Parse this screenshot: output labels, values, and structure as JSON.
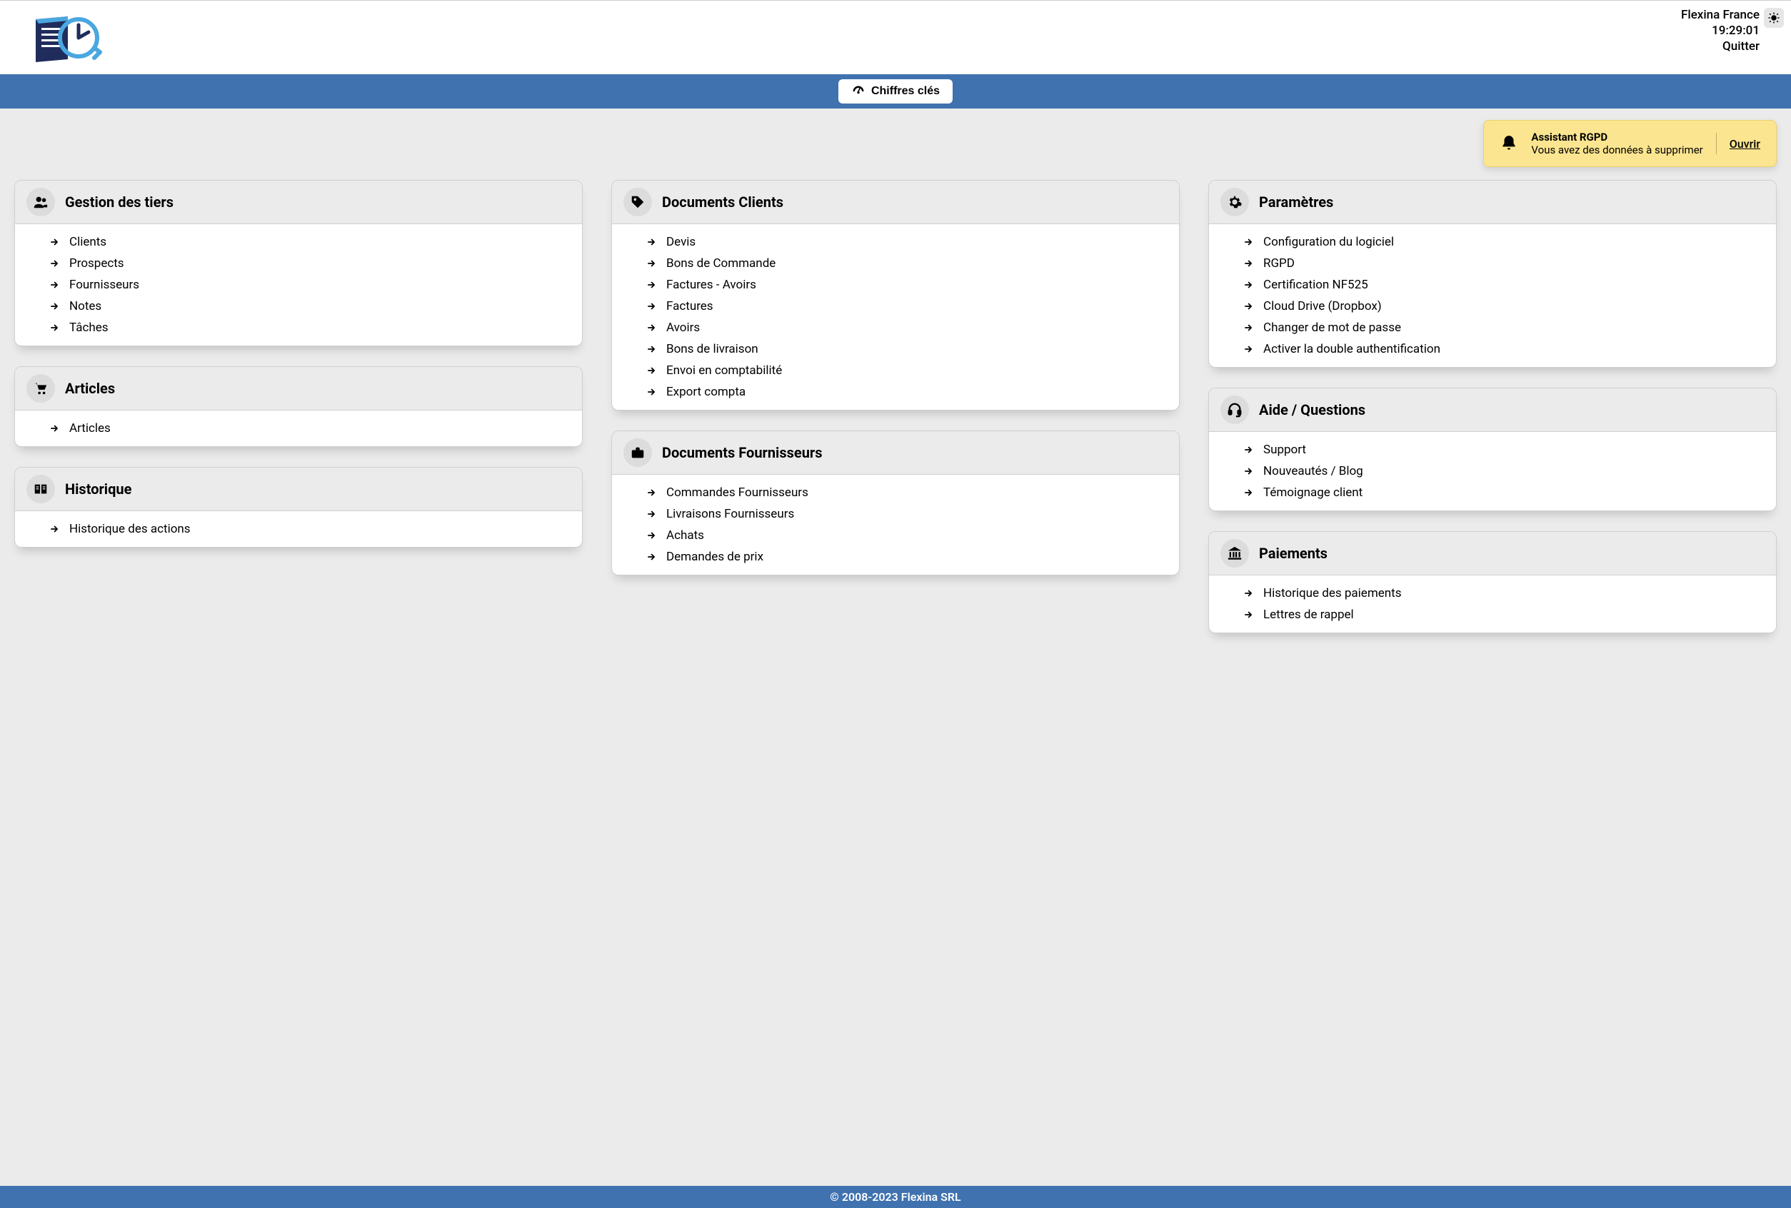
{
  "header": {
    "company": "Flexina France",
    "clock": "19:29:01",
    "quit": "Quitter"
  },
  "toolbar": {
    "chiffres": "Chiffres clés"
  },
  "notification": {
    "title": "Assistant RGPD",
    "body": "Vous avez des données à supprimer",
    "open": "Ouvrir"
  },
  "cards": {
    "tiers": {
      "title": "Gestion des tiers",
      "items": [
        "Clients",
        "Prospects",
        "Fournisseurs",
        "Notes",
        "Tâches"
      ]
    },
    "articles": {
      "title": "Articles",
      "items": [
        "Articles"
      ]
    },
    "historique": {
      "title": "Historique",
      "items": [
        "Historique des actions"
      ]
    },
    "docs_clients": {
      "title": "Documents Clients",
      "items": [
        "Devis",
        "Bons de Commande",
        "Factures - Avoirs",
        "Factures",
        "Avoirs",
        "Bons de livraison",
        "Envoi en comptabilité",
        "Export compta"
      ]
    },
    "docs_fournisseurs": {
      "title": "Documents Fournisseurs",
      "items": [
        "Commandes Fournisseurs",
        "Livraisons Fournisseurs",
        "Achats",
        "Demandes de prix"
      ]
    },
    "parametres": {
      "title": "Paramètres",
      "items": [
        "Configuration du logiciel",
        "RGPD",
        "Certification NF525",
        "Cloud Drive (Dropbox)",
        "Changer de mot de passe",
        "Activer la double authentification"
      ]
    },
    "aide": {
      "title": "Aide / Questions",
      "items": [
        "Support",
        "Nouveautés / Blog",
        "Témoignage client"
      ]
    },
    "paiements": {
      "title": "Paiements",
      "items": [
        "Historique des paiements",
        "Lettres de rappel"
      ]
    }
  },
  "footer": "© 2008-2023 Flexina SRL"
}
